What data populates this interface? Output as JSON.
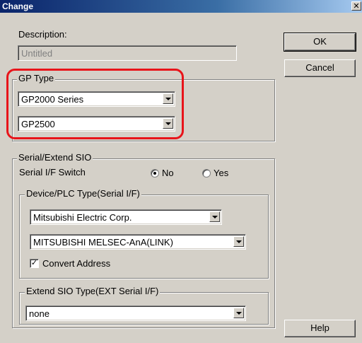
{
  "window": {
    "title": "Change",
    "close_glyph": "✕"
  },
  "description": {
    "label": "Description:",
    "value": "Untitled"
  },
  "buttons": {
    "ok": "OK",
    "cancel": "Cancel",
    "help": "Help"
  },
  "gp_type": {
    "label": "GP Type",
    "series": "GP2000 Series",
    "model": "GP2500"
  },
  "serial": {
    "label": "Serial/Extend SIO",
    "switch_label": "Serial I/F Switch",
    "option_no": "No",
    "option_yes": "Yes",
    "selected": "No"
  },
  "device": {
    "label": "Device/PLC Type(Serial I/F)",
    "maker": "Mitsubishi Electric Corp.",
    "model": "MITSUBISHI MELSEC-AnA(LINK)",
    "convert_label": "Convert Address",
    "convert_checked": true,
    "check_glyph": "✓"
  },
  "extend_sio": {
    "label": "Extend SIO Type(EXT Serial I/F)",
    "value": "none"
  },
  "colors": {
    "highlight": "#e8141a",
    "face": "#d4d0c8",
    "title_bar": "#0a246a"
  }
}
